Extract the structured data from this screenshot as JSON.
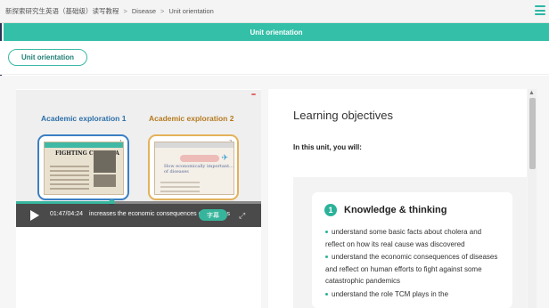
{
  "breadcrumb": {
    "course": "新探索研究生英语（基础级）读写教程",
    "section": "Disease",
    "page": "Unit orientation",
    "separator": ">"
  },
  "header": {
    "title": "Unit orientation"
  },
  "tabs": {
    "active_label": "Unit orientation"
  },
  "video": {
    "card1_title": "Academic exploration 1",
    "card1_number": "1",
    "card1_thumb_headline": "FIGHTING CHOLERA",
    "card2_title": "Academic exploration 2",
    "card2_number": "2",
    "card2_thumb_headline": "How economically important... of diseases",
    "time_current": "01:47",
    "time_total": "04:24",
    "subtitle": "increases the economic consequences of diseases",
    "subtitle_button": "字幕",
    "progress_fraction": 0.39,
    "icons": {
      "play": "play-icon",
      "fullscreen": "fullscreen-icon",
      "plane": "airplane-icon"
    }
  },
  "objectives": {
    "heading": "Learning objectives",
    "intro": "In this unit, you will:",
    "section_number": "1",
    "section_title": "Knowledge & thinking",
    "items": [
      "understand some basic facts about cholera and reflect on how its real cause was discovered",
      "understand the economic consequences of diseases and reflect on human efforts to fight against some catastrophic pandemics",
      "understand the role TCM plays in the"
    ]
  },
  "colors": {
    "accent": "#34c0a8",
    "card1_border": "#3b7fc4",
    "card2_border": "#e3b25a"
  }
}
